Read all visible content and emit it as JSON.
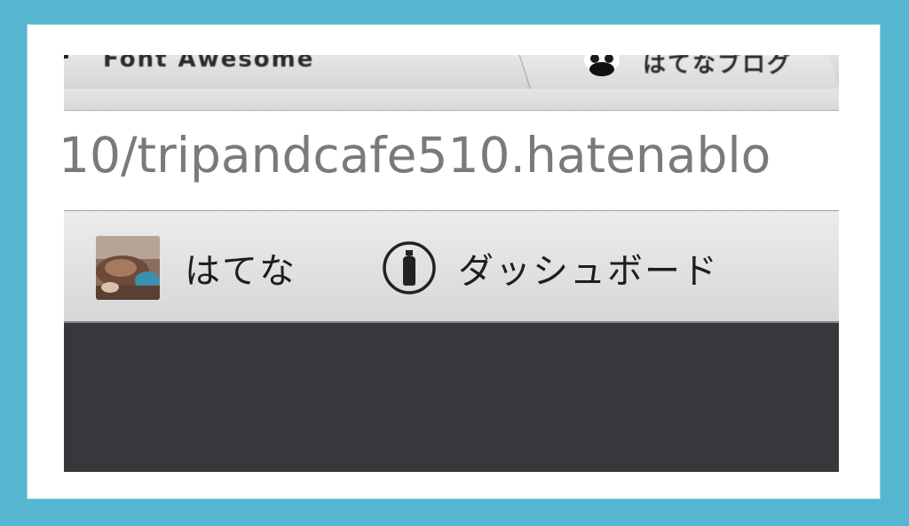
{
  "tabs": [
    {
      "title": "Font Awesome",
      "state": "active"
    },
    {
      "title": "はてなブログ",
      "state": "inactive"
    }
  ],
  "address_bar": {
    "url": "10/tripandcafe510.hatenablo"
  },
  "bookmarks": [
    {
      "label": "はてな",
      "icon": "photo-thumbnail"
    },
    {
      "label": "ダッシュボード",
      "icon": "circle-bottle-icon"
    }
  ],
  "colors": {
    "page_background": "#57b6cf",
    "frame": "#ffffff",
    "url_text": "#7a7a7a",
    "content_dark": "#38383c"
  }
}
